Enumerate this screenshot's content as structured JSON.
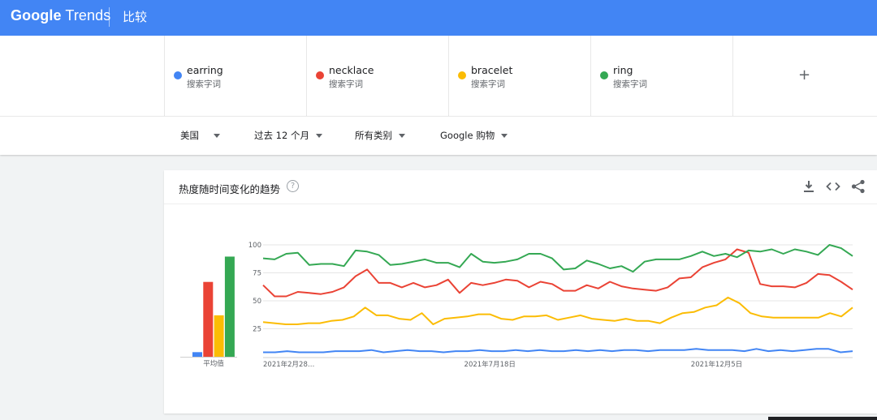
{
  "app": {
    "logo_google": "Google",
    "logo_trends": "Trends",
    "page_title": "比较"
  },
  "terms": [
    {
      "name": "earring",
      "type": "搜索字词",
      "color": "#4285f4"
    },
    {
      "name": "necklace",
      "type": "搜索字词",
      "color": "#ea4335"
    },
    {
      "name": "bracelet",
      "type": "搜索字词",
      "color": "#fbbc04"
    },
    {
      "name": "ring",
      "type": "搜索字词",
      "color": "#34a853"
    }
  ],
  "add_term_symbol": "+",
  "filters": {
    "region": "美国",
    "time_range": "过去 12 个月",
    "category": "所有类别",
    "search_type": "Google 购物"
  },
  "chart_card": {
    "title": "热度随时间变化的趋势",
    "help_symbol": "?",
    "icons": [
      "download-icon",
      "embed-icon",
      "share-icon"
    ]
  },
  "chart_data": {
    "type": "line",
    "averages_label": "平均值",
    "averages": [
      {
        "name": "earring",
        "value": 4
      },
      {
        "name": "necklace",
        "value": 65
      },
      {
        "name": "bracelet",
        "value": 36
      },
      {
        "name": "ring",
        "value": 87
      }
    ],
    "y_ticks": [
      100,
      75,
      50,
      25
    ],
    "ylim": [
      0,
      100
    ],
    "x_tick_labels": [
      {
        "label": "2021年2月28…",
        "index": 0
      },
      {
        "label": "2021年7月18日",
        "index": 20
      },
      {
        "label": "2021年12月5日",
        "index": 40
      }
    ],
    "grid": true,
    "series": [
      {
        "name": "earring",
        "color": "#4285f4",
        "values": [
          4,
          4,
          5,
          4,
          4,
          4,
          5,
          5,
          5,
          6,
          4,
          5,
          6,
          5,
          5,
          4,
          5,
          5,
          6,
          5,
          5,
          6,
          5,
          6,
          5,
          5,
          6,
          5,
          6,
          5,
          6,
          6,
          5,
          6,
          6,
          6,
          7,
          6,
          6,
          6,
          5,
          7,
          5,
          6,
          5,
          6,
          7,
          7,
          4,
          5
        ]
      },
      {
        "name": "necklace",
        "color": "#ea4335",
        "values": [
          64,
          54,
          54,
          58,
          57,
          56,
          58,
          62,
          72,
          78,
          66,
          66,
          62,
          66,
          62,
          64,
          69,
          57,
          66,
          64,
          66,
          69,
          68,
          62,
          67,
          65,
          59,
          59,
          64,
          61,
          67,
          63,
          61,
          60,
          59,
          62,
          70,
          71,
          80,
          84,
          87,
          96,
          93,
          65,
          63,
          63,
          62,
          66,
          74,
          73,
          67,
          60
        ]
      },
      {
        "name": "bracelet",
        "color": "#fbbc04",
        "values": [
          31,
          30,
          29,
          29,
          30,
          30,
          32,
          33,
          36,
          44,
          37,
          37,
          34,
          33,
          39,
          29,
          34,
          35,
          36,
          38,
          38,
          34,
          33,
          36,
          36,
          37,
          33,
          35,
          37,
          34,
          33,
          32,
          34,
          32,
          32,
          30,
          35,
          39,
          40,
          44,
          46,
          53,
          48,
          39,
          36,
          35,
          35,
          35,
          35,
          35,
          39,
          36,
          44
        ]
      },
      {
        "name": "ring",
        "color": "#34a853",
        "values": [
          88,
          87,
          92,
          93,
          82,
          83,
          83,
          81,
          95,
          94,
          91,
          82,
          83,
          85,
          87,
          84,
          84,
          80,
          92,
          85,
          84,
          85,
          87,
          92,
          92,
          88,
          78,
          79,
          86,
          83,
          79,
          81,
          76,
          85,
          87,
          87,
          87,
          90,
          94,
          90,
          92,
          89,
          95,
          94,
          96,
          92,
          96,
          94,
          91,
          100,
          97,
          90
        ]
      }
    ]
  }
}
